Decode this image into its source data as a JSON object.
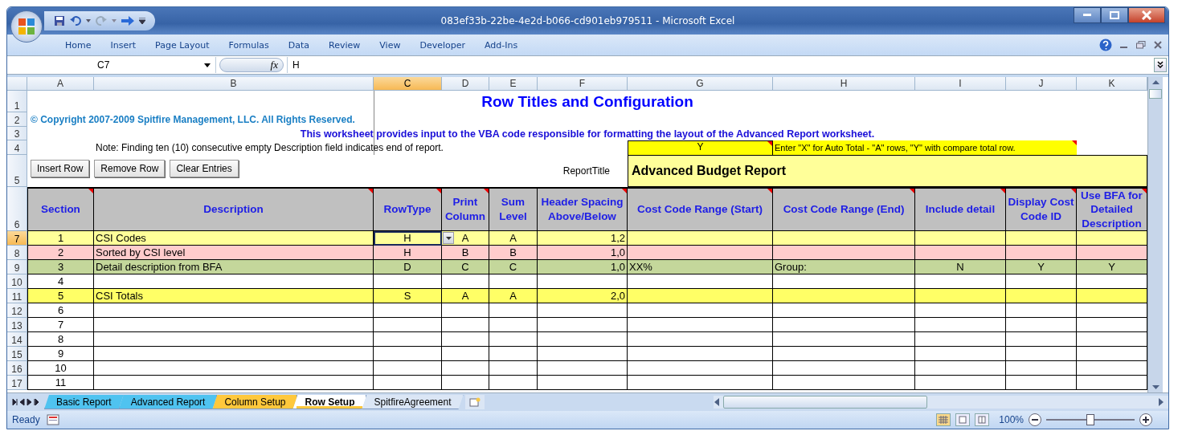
{
  "window": {
    "title": "083ef33b-22be-4e2d-b066-cd901eb979511 - Microsoft Excel"
  },
  "ribbon_tabs": [
    "Home",
    "Insert",
    "Page Layout",
    "Formulas",
    "Data",
    "Review",
    "View",
    "Developer",
    "Add-Ins"
  ],
  "formula_bar": {
    "name_box": "C7",
    "function_button": "fx",
    "formula": "H"
  },
  "column_headers": [
    {
      "label": "A",
      "selected": false
    },
    {
      "label": "B",
      "selected": false
    },
    {
      "label": "C",
      "selected": true
    },
    {
      "label": "D",
      "selected": false
    },
    {
      "label": "E",
      "selected": false
    },
    {
      "label": "F",
      "selected": false
    },
    {
      "label": "G",
      "selected": false
    },
    {
      "label": "H",
      "selected": false
    },
    {
      "label": "I",
      "selected": false
    },
    {
      "label": "J",
      "selected": false
    },
    {
      "label": "K",
      "selected": false
    }
  ],
  "row_numbers": [
    {
      "label": "1",
      "selected": false
    },
    {
      "label": "2",
      "selected": false
    },
    {
      "label": "3",
      "selected": false
    },
    {
      "label": "4",
      "selected": false
    },
    {
      "label": "5",
      "selected": false
    },
    {
      "label": "6",
      "selected": false
    },
    {
      "label": "7",
      "selected": true
    },
    {
      "label": "8",
      "selected": false
    },
    {
      "label": "9",
      "selected": false
    },
    {
      "label": "10",
      "selected": false
    },
    {
      "label": "11",
      "selected": false
    },
    {
      "label": "12",
      "selected": false
    },
    {
      "label": "13",
      "selected": false
    },
    {
      "label": "14",
      "selected": false
    },
    {
      "label": "15",
      "selected": false
    },
    {
      "label": "16",
      "selected": false
    },
    {
      "label": "17",
      "selected": false
    }
  ],
  "sheet": {
    "title": "Row Titles and Configuration",
    "copyright": "© Copyright 2007-2009 Spitfire Management, LLC. All Rights Reserved.",
    "subtitle": "This worksheet provides input to the VBA code responsible for formatting the layout of the Advanced Report worksheet.",
    "note": "Note: Finding ten (10) consecutive empty Description field indicates end of report.",
    "total_flag": "Y",
    "total_flag_note": "Enter \"X\" for Auto Total - \"A\" rows,  \"Y\" with compare total row.",
    "report_title_label": "ReportTitle",
    "report_title": "Advanced Budget Report",
    "buttons": [
      "Insert Row",
      "Remove Row",
      "Clear Entries"
    ]
  },
  "table": {
    "columns": [
      {
        "label": "Section",
        "comment": true
      },
      {
        "label": "Description",
        "comment": true
      },
      {
        "label": "RowType",
        "comment": true
      },
      {
        "label": "Print Column",
        "comment": true
      },
      {
        "label": "Sum Level",
        "comment": false
      },
      {
        "label": "Header Spacing Above/Below",
        "comment": true
      },
      {
        "label": "Cost Code Range (Start)",
        "comment": true
      },
      {
        "label": "Cost Code Range (End)",
        "comment": true
      },
      {
        "label": "Include detail",
        "comment": true
      },
      {
        "label": "Display Cost Code ID",
        "comment": true
      },
      {
        "label": "Use BFA for Detailed Description",
        "comment": true
      }
    ],
    "rows": [
      {
        "selected": true,
        "color": "#ffff99",
        "cells": {
          "A": "1",
          "B": "CSI Codes",
          "C": "H",
          "D": "A",
          "E": "A",
          "F": "1,2"
        }
      },
      {
        "selected": false,
        "color": "#ffcccc",
        "cells": {
          "A": "2",
          "B": "Sorted by CSI level",
          "C": "H",
          "D": "B",
          "E": "B",
          "F": "1,0"
        }
      },
      {
        "selected": false,
        "color": "#c4d79b",
        "cells": {
          "A": "3",
          "B": "Detail description from BFA",
          "C": "D",
          "D": "C",
          "E": "C",
          "F": "1,0",
          "G": "XX%",
          "H": "Group:",
          "I": "N",
          "J": "Y",
          "K": "Y"
        }
      },
      {
        "selected": false,
        "color": "#ffffff",
        "cells": {
          "A": "4"
        }
      },
      {
        "selected": false,
        "color": "#ffff66",
        "cells": {
          "A": "5",
          "B": "CSI Totals",
          "C": "S",
          "D": "A",
          "E": "A",
          "F": "2,0"
        }
      },
      {
        "selected": false,
        "color": "#ffffff",
        "cells": {
          "A": "6"
        }
      },
      {
        "selected": false,
        "color": "#ffffff",
        "cells": {
          "A": "7"
        }
      },
      {
        "selected": false,
        "color": "#ffffff",
        "cells": {
          "A": "8"
        }
      },
      {
        "selected": false,
        "color": "#ffffff",
        "cells": {
          "A": "9"
        }
      },
      {
        "selected": false,
        "color": "#ffffff",
        "cells": {
          "A": "10"
        }
      },
      {
        "selected": false,
        "color": "#ffffff",
        "cells": {
          "A": "11"
        }
      }
    ]
  },
  "sheet_tabs": [
    {
      "label": "Basic Report",
      "selected": false,
      "color": "#4fc3f0"
    },
    {
      "label": "Advanced Report",
      "selected": false,
      "color": "#4fc3f0"
    },
    {
      "label": "Column Setup",
      "selected": false,
      "color": "#ffc83c"
    },
    {
      "label": "Row Setup",
      "selected": true,
      "color": "#ffc83c"
    },
    {
      "label": "SpitfireAgreement",
      "selected": false,
      "color": "#dbe6f5"
    }
  ],
  "status_bar": {
    "status": "Ready",
    "zoom": "100%",
    "zoom_level": {
      "level": 0.5
    }
  }
}
